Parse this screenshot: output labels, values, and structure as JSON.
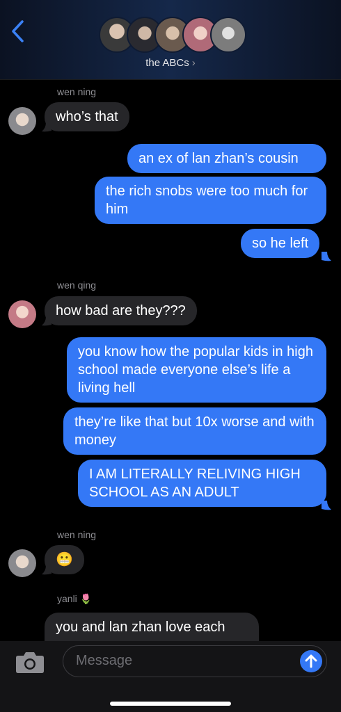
{
  "header": {
    "group_name": "the ABCs",
    "chevron": "›",
    "avatar_colors": [
      "#5a5148",
      "#4a4a52",
      "#7a6a5c",
      "#c98b8b",
      "#9a9a9a"
    ]
  },
  "messages": [
    {
      "sender": "wen ning",
      "text": "who’s that",
      "direction": "in"
    },
    {
      "text": "an ex of lan zhan’s cousin",
      "direction": "out"
    },
    {
      "text": "the rich snobs were too much for him",
      "direction": "out"
    },
    {
      "text": "so he left",
      "direction": "out"
    },
    {
      "sender": "wen qing",
      "text": "how bad are they???",
      "direction": "in"
    },
    {
      "text": "you know how the popular kids in high school made everyone else’s life a living hell",
      "direction": "out"
    },
    {
      "text": "they’re like that but 10x worse and with money",
      "direction": "out"
    },
    {
      "text": "I AM LITERALLY RELIVING HIGH SCHOOL AS AN ADULT",
      "direction": "out"
    },
    {
      "sender": "wen ning",
      "text": "😬",
      "direction": "in"
    },
    {
      "sender": "yanli 🌷",
      "text": "you and lan zhan love each",
      "direction": "in"
    }
  ],
  "compose": {
    "placeholder": "Message",
    "camera_icon": "camera-icon",
    "send_icon": "arrow-up-icon"
  },
  "colors": {
    "outgoing": "#3478f6",
    "incoming": "#262629",
    "background": "#000000"
  }
}
